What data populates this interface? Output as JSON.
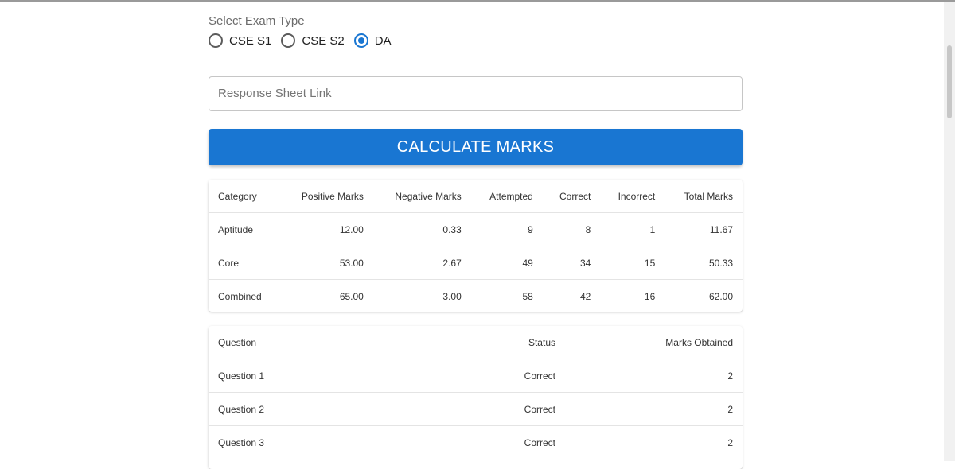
{
  "exam": {
    "label": "Select Exam Type",
    "options": [
      {
        "label": "CSE S1",
        "checked": false
      },
      {
        "label": "CSE S2",
        "checked": false
      },
      {
        "label": "DA",
        "checked": true
      }
    ]
  },
  "link_field": {
    "placeholder": "Response Sheet Link",
    "value": ""
  },
  "calculate_button": {
    "label": "CALCULATE MARKS"
  },
  "summary_table": {
    "headers": [
      "Category",
      "Positive Marks",
      "Negative Marks",
      "Attempted",
      "Correct",
      "Incorrect",
      "Total Marks"
    ],
    "rows": [
      [
        "Aptitude",
        "12.00",
        "0.33",
        "9",
        "8",
        "1",
        "11.67"
      ],
      [
        "Core",
        "53.00",
        "2.67",
        "49",
        "34",
        "15",
        "50.33"
      ],
      [
        "Combined",
        "65.00",
        "3.00",
        "58",
        "42",
        "16",
        "62.00"
      ]
    ]
  },
  "question_table": {
    "headers": [
      "Question",
      "Status",
      "Marks Obtained"
    ],
    "rows": [
      [
        "Question 1",
        "Correct",
        "2"
      ],
      [
        "Question 2",
        "Correct",
        "2"
      ],
      [
        "Question 3",
        "Correct",
        "2"
      ]
    ]
  },
  "colors": {
    "accent": "#1976d2"
  }
}
